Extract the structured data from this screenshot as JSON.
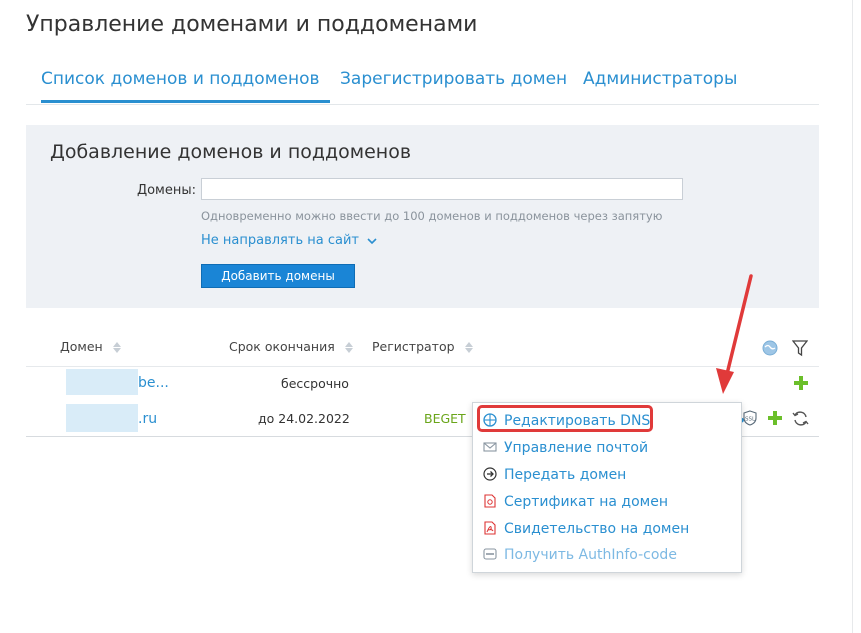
{
  "page": {
    "title": "Управление доменами и поддоменами"
  },
  "tabs": [
    {
      "label": "Список доменов и поддоменов",
      "active": true
    },
    {
      "label": "Зарегистрировать домен",
      "active": false
    },
    {
      "label": "Администраторы",
      "active": false
    }
  ],
  "add_panel": {
    "title": "Добавление доменов и поддоменов",
    "domains_label": "Домены:",
    "domains_value": "",
    "domains_placeholder": "",
    "hint": "Одновременно можно ввести до 100 доменов и поддоменов через запятую",
    "redirect_label": "Не направлять на сайт",
    "add_button": "Добавить домены"
  },
  "table": {
    "headers": {
      "domain": "Домен",
      "expiry": "Срок окончания",
      "registrar": "Регистратор"
    },
    "rows": [
      {
        "domain": "be...",
        "expiry": "бессрочно",
        "registrar": ""
      },
      {
        "domain": ".ru",
        "expiry": "до 24.02.2022",
        "registrar": "BEGET"
      }
    ]
  },
  "context_menu": {
    "items": [
      {
        "label": "Редактировать DNS",
        "icon": "dns-globe-icon",
        "highlighted": true
      },
      {
        "label": "Управление почтой",
        "icon": "mail-icon"
      },
      {
        "label": "Передать домен",
        "icon": "transfer-arrow-icon"
      },
      {
        "label": "Сертификат на домен",
        "icon": "pdf-certificate-icon"
      },
      {
        "label": "Свидетельство на домен",
        "icon": "pdf-document-icon"
      },
      {
        "label": "Получить AuthInfo-code",
        "icon": "auth-icon",
        "disabled": true
      }
    ]
  },
  "row_actions": {
    "more": "•••",
    "ssl_badge": "SSL"
  },
  "colors": {
    "accent": "#2a8fd0",
    "panel": "#eef1f5",
    "button": "#1a85d6",
    "registrar": "#6aa51a",
    "plus": "#6bbf2a",
    "annotation": "#e03a3a"
  }
}
